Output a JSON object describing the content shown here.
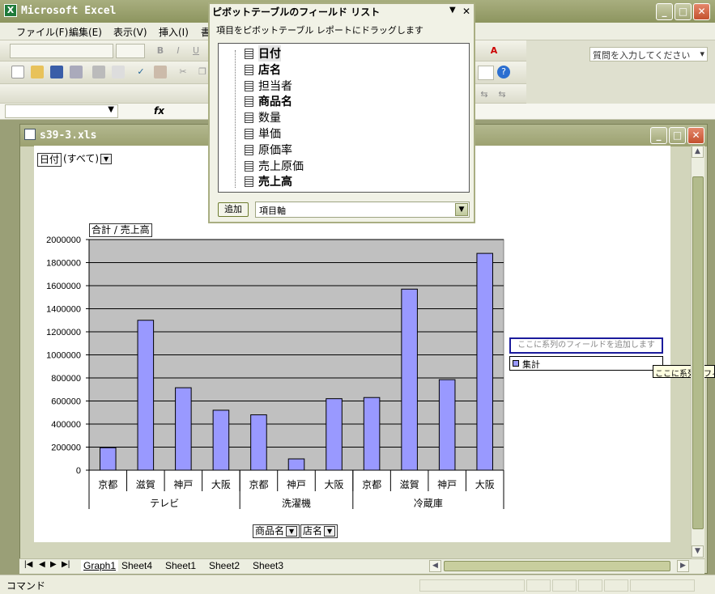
{
  "app": {
    "title": "Microsoft Excel",
    "icon": "excel-icon"
  },
  "menu": [
    "ファイル(F)",
    "編集(E)",
    "表示(V)",
    "挿入(I)",
    "書"
  ],
  "help_placeholder": "質問を入力してください",
  "formula": {
    "fx": "fx"
  },
  "workbook": {
    "title": "s39-3.xls"
  },
  "pivot_fields": {
    "title": "ピボットテーブルのフィールド リスト",
    "description": "項目をピボットテーブル レポートにドラッグします",
    "fields": [
      "日付",
      "店名",
      "担当者",
      "商品名",
      "数量",
      "単価",
      "原価率",
      "売上原価",
      "売上高"
    ],
    "bold_fields": [
      "日付",
      "店名",
      "商品名",
      "売上高"
    ],
    "add_label": "追加",
    "area_value": "項目軸"
  },
  "page_field": {
    "name": "日付",
    "value": "(すべて)"
  },
  "data_field": "合計 / 売上高",
  "row_fields": [
    "商品名",
    "店名"
  ],
  "series_drop_hint": "ここに系列のフィールドを追加します",
  "tooltip": "ここに系列のフィ",
  "sheet_tabs": [
    "Graph1",
    "Sheet4",
    "Sheet1",
    "Sheet2",
    "Sheet3"
  ],
  "active_tab": "Graph1",
  "status": "コマンド",
  "chart_data": {
    "type": "bar",
    "categories": [
      {
        "group": "テレビ",
        "items": [
          "京都",
          "滋賀",
          "神戸",
          "大阪"
        ]
      },
      {
        "group": "洗濯機",
        "items": [
          "京都",
          "神戸",
          "大阪"
        ]
      },
      {
        "group": "冷蔵庫",
        "items": [
          "京都",
          "滋賀",
          "神戸",
          "大阪"
        ]
      }
    ],
    "series": [
      {
        "name": "集計",
        "values": [
          195000,
          1300000,
          715000,
          520000,
          480000,
          98000,
          620000,
          630000,
          1570000,
          785000,
          1880000
        ],
        "color": "#9999ff"
      }
    ],
    "ylim": [
      0,
      2000000
    ],
    "yticks": [
      0,
      200000,
      400000,
      600000,
      800000,
      1000000,
      1200000,
      1400000,
      1600000,
      1800000,
      2000000
    ],
    "plot_bg": "#c0c0c0",
    "grid": true,
    "legend": "right"
  }
}
